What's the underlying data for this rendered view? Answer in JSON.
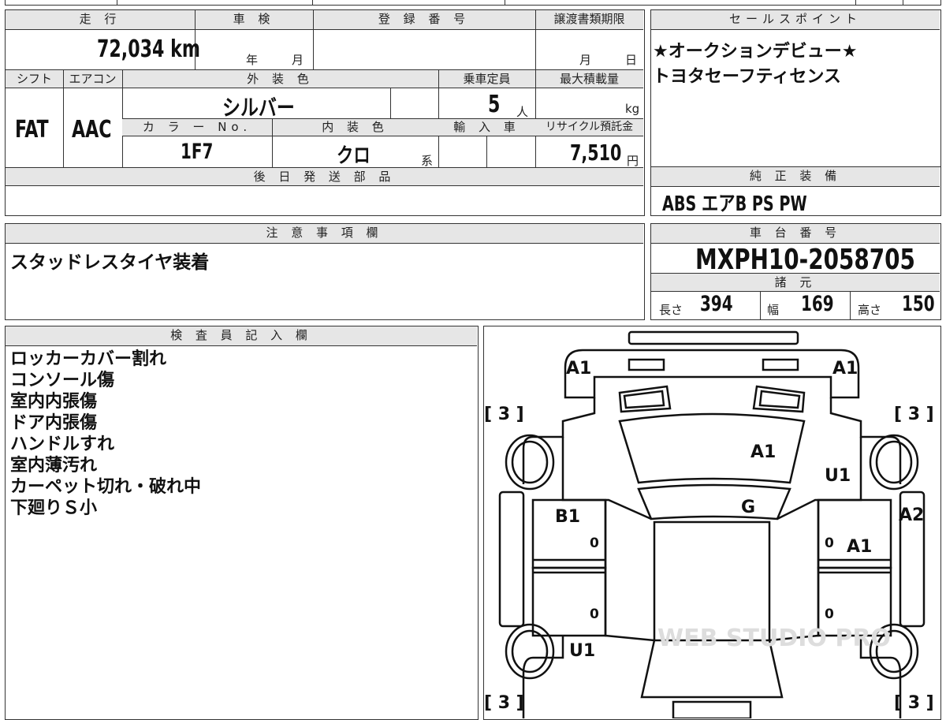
{
  "top_section": {
    "headers": {
      "mileage": "走 行",
      "inspection": "車 検",
      "registration": "登 録 番 号",
      "transfer_deadline": "譲渡書類期限",
      "shift": "シフト",
      "aircon": "エアコン",
      "exterior_color": "外 装 色",
      "capacity": "乗車定員",
      "max_load": "最大積載量",
      "color_no": "カ ラ ー No.",
      "interior_color": "内 装 色",
      "imported": "輸 入 車",
      "recycle_fee": "リサイクル預託金",
      "later_parts": "後 日 発 送 部 品"
    },
    "values": {
      "mileage": "72,034 km",
      "year_unit": "年",
      "month_unit": "月",
      "deadline_month": "月",
      "deadline_day": "日",
      "shift": "FAT",
      "aircon": "AAC",
      "exterior_color": "シルバー",
      "capacity": "5",
      "capacity_unit": "人",
      "load_unit": "kg",
      "color_no": "1F7",
      "interior_color": "クロ",
      "interior_suffix": "系",
      "recycle_fee": "7,510",
      "recycle_unit": "円"
    }
  },
  "sales_points": {
    "header": "セールスポイント",
    "lines": [
      "★オークションデビュー★",
      "トヨタセーフティセンス"
    ]
  },
  "equipment": {
    "header": "純 正 装 備",
    "value": "ABS エアB PS PW"
  },
  "notes": {
    "header": "注 意 事 項 欄",
    "value": "スタッドレスタイヤ装着"
  },
  "chassis": {
    "header": "車 台 番 号",
    "value": "MXPH10-2058705",
    "spec_header": "諸 元",
    "length_label": "長さ",
    "length": "394",
    "width_label": "幅",
    "width": "169",
    "height_label": "高さ",
    "height": "150"
  },
  "inspector": {
    "header": "検 査 員 記 入 欄",
    "lines": [
      "ロッカーカバー割れ",
      "コンソール傷",
      "室内内張傷",
      "ドア内張傷",
      "ハンドルすれ",
      "室内薄汚れ",
      "カーペット切れ・破れ中",
      "下廻りＳ小"
    ]
  },
  "car_map": {
    "marks": [
      {
        "code": "A1",
        "location": "front-left"
      },
      {
        "code": "A1",
        "location": "front-right"
      },
      {
        "code": "[ 3 ]",
        "location": "tire-front-left"
      },
      {
        "code": "[ 3 ]",
        "location": "tire-front-right"
      },
      {
        "code": "A1",
        "location": "windshield"
      },
      {
        "code": "U1",
        "location": "right-front-fender"
      },
      {
        "code": "G",
        "location": "roof-front"
      },
      {
        "code": "B1",
        "location": "left-front-door"
      },
      {
        "code": "A2",
        "location": "right-side"
      },
      {
        "code": "A1",
        "location": "right-front-door"
      },
      {
        "code": "U1",
        "location": "left-rear-fender"
      },
      {
        "code": "[ 3 ]",
        "location": "tire-rear-left"
      },
      {
        "code": "[ 3 ]",
        "location": "tire-rear-right"
      }
    ],
    "door_zero": "0",
    "watermark": "WEB STUDIO PRO"
  }
}
